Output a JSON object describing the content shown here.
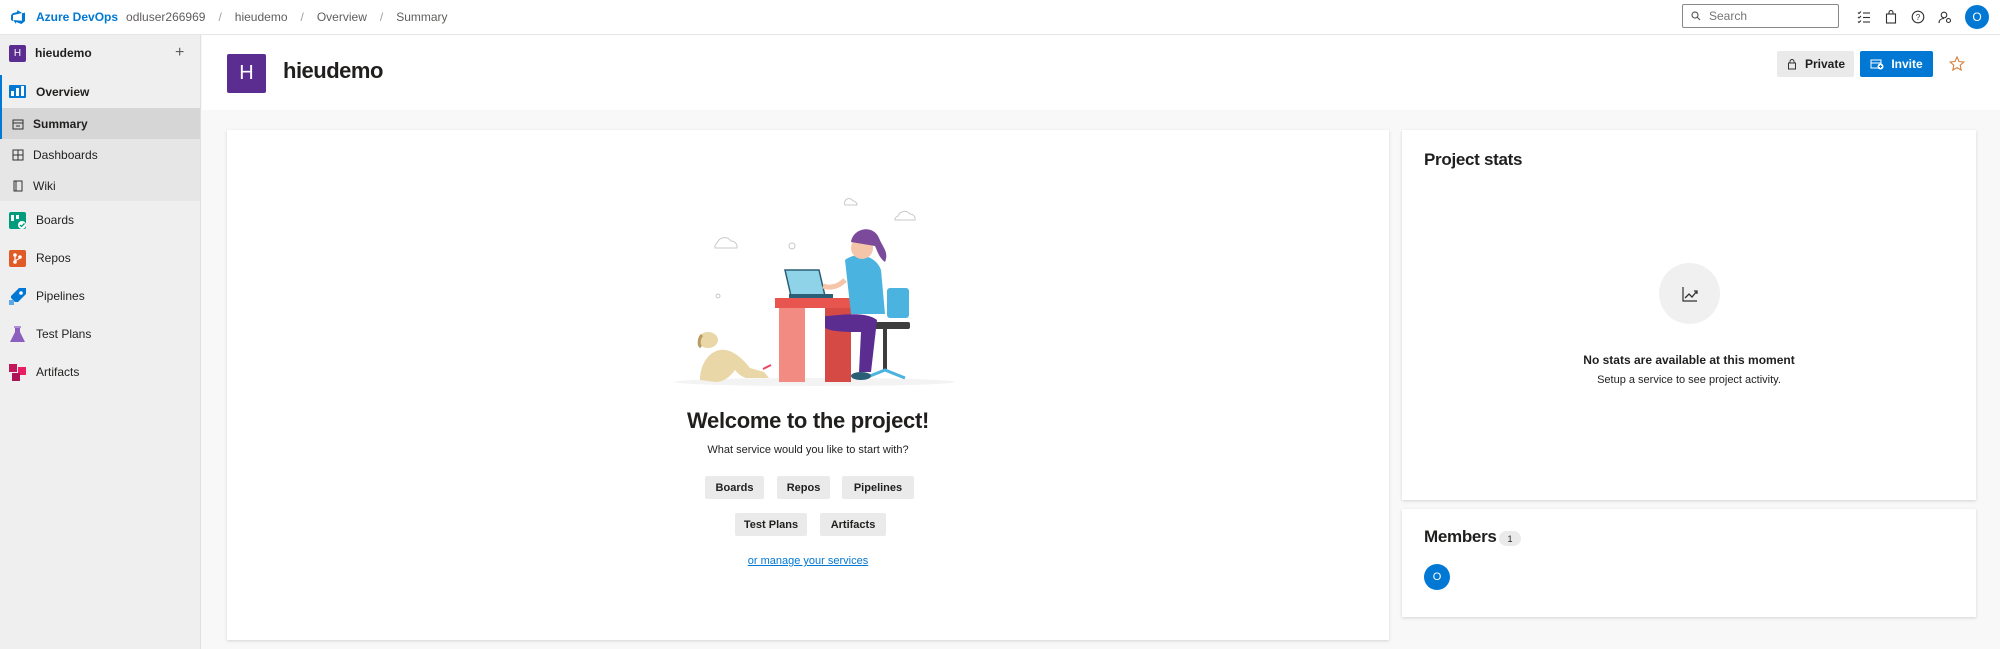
{
  "topbar": {
    "brand": "Azure DevOps",
    "org": "odluser266969",
    "breadcrumbs": [
      "hieudemo",
      "Overview",
      "Summary"
    ],
    "search_placeholder": "Search",
    "user_initial": "O"
  },
  "sidebar": {
    "project_initial": "H",
    "project_name": "hieudemo",
    "add_label": "+",
    "overview": {
      "label": "Overview"
    },
    "overview_items": [
      {
        "label": "Summary",
        "selected": true
      },
      {
        "label": "Dashboards"
      },
      {
        "label": "Wiki"
      }
    ],
    "services": [
      {
        "label": "Boards",
        "icon": "boards-icon",
        "color": "#009c7b"
      },
      {
        "label": "Repos",
        "icon": "repos-icon",
        "color": "#e05b26"
      },
      {
        "label": "Pipelines",
        "icon": "pipelines-icon",
        "color": "#0078d4"
      },
      {
        "label": "Test Plans",
        "icon": "test-plans-icon",
        "color": "#8c5fbf"
      },
      {
        "label": "Artifacts",
        "icon": "artifacts-icon",
        "color": "#c2185b"
      }
    ]
  },
  "header": {
    "project_initial": "H",
    "title": "hieudemo",
    "private_label": "Private",
    "invite_label": "Invite"
  },
  "main": {
    "welcome_title": "Welcome to the project!",
    "welcome_subtitle": "What service would you like to start with?",
    "service_buttons": [
      "Boards",
      "Repos",
      "Pipelines",
      "Test Plans",
      "Artifacts"
    ],
    "manage_link": "or manage your services"
  },
  "stats": {
    "title": "Project stats",
    "empty_title": "No stats are available at this moment",
    "empty_subtitle": "Setup a service to see project activity."
  },
  "members": {
    "title": "Members",
    "count": "1",
    "avatar_initial": "O"
  },
  "colors": {
    "accent": "#0078d4",
    "project_badge": "#5c2d91"
  }
}
